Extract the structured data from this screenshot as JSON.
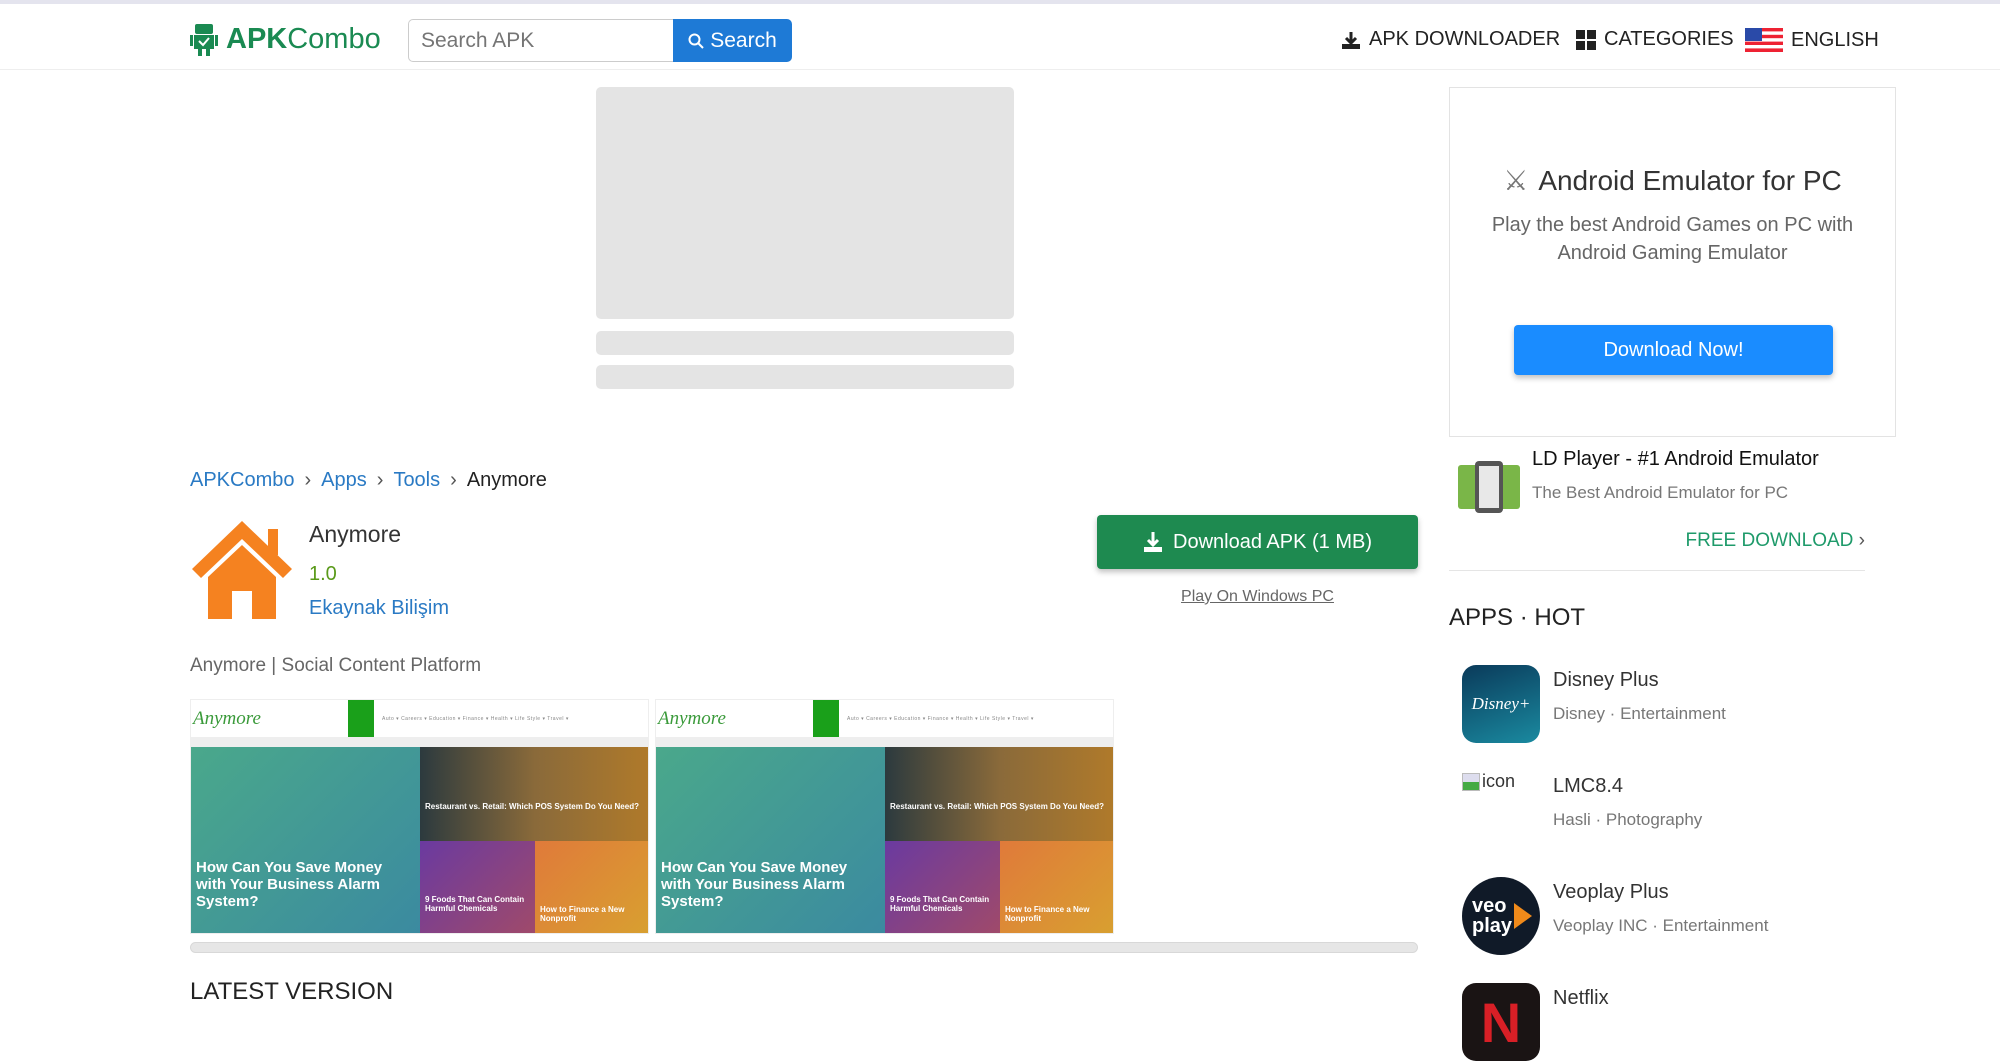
{
  "header": {
    "logo_text_bold": "APK",
    "logo_text": "Combo",
    "search_placeholder": "Search APK",
    "search_label": "Search",
    "nav": [
      {
        "label": "APK DOWNLOADER",
        "icon": "download-icon"
      },
      {
        "label": "CATEGORIES",
        "icon": "grid-icon"
      },
      {
        "label": "ENGLISH",
        "icon": "us-flag-icon"
      }
    ]
  },
  "breadcrumb": [
    "APKCombo",
    "Apps",
    "Tools",
    "Anymore"
  ],
  "app": {
    "name": "Anymore",
    "version": "1.0",
    "developer": "Ekaynak Bilişim",
    "tagline": "Anymore | Social Content Platform",
    "download_label": "Download APK (1 MB)",
    "play_pc_label": "Play On Windows PC"
  },
  "screenshots": [
    {
      "site": "Anymore",
      "headline": "How Can You Save Money with Your Business Alarm System?",
      "tile2": "Restaurant vs. Retail: Which POS System Do You Need?",
      "tile3": "9 Foods That Can Contain Harmful Chemicals",
      "tile4": "How to Finance a New Nonprofit"
    },
    {
      "site": "Anymore",
      "headline": "How Can You Save Money with Your Business Alarm System?",
      "tile2": "Restaurant vs. Retail: Which POS System Do You Need?",
      "tile3": "9 Foods That Can Contain Harmful Chemicals",
      "tile4": "How to Finance a New Nonprofit"
    }
  ],
  "latest_version_heading": "LATEST VERSION",
  "sidebar": {
    "ad": {
      "title": "Android Emulator for PC",
      "subtitle": "Play the best Android Games on PC with Android Gaming Emulator",
      "button": "Download Now!"
    },
    "ldplayer": {
      "title": "LD Player - #1 Android Emulator",
      "subtitle": "The Best Android Emulator for PC",
      "cta": "FREE DOWNLOAD"
    },
    "hot_heading": "APPS · HOT",
    "apps": [
      {
        "name": "Disney Plus",
        "meta": "Disney · Entertainment"
      },
      {
        "name": "LMC8.4",
        "meta": "Hasli · Photography",
        "icon_alt": "icon"
      },
      {
        "name": "Veoplay Plus",
        "meta": "Veoplay INC · Entertainment"
      },
      {
        "name": "Netflix",
        "meta": ""
      }
    ]
  },
  "colors": {
    "brand": "#1a8a52",
    "search": "#1e7ad6",
    "link": "#2a7ac4",
    "download": "#1e8a50",
    "cta": "#1a8cff"
  }
}
